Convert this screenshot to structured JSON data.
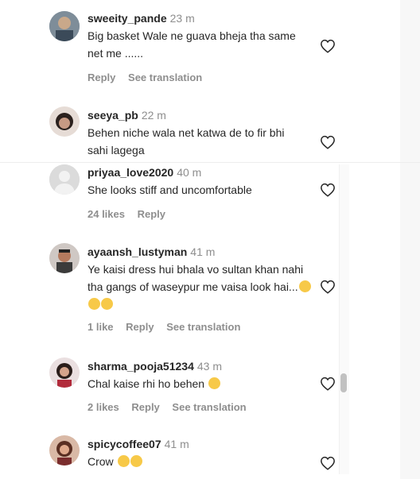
{
  "comments": [
    {
      "user": "sweeity_pande",
      "time": "23 m",
      "text": "Big basket Wale ne guava bheja tha same net me ......",
      "actions": [
        "Reply",
        "See translation"
      ],
      "emoji_count": 0
    },
    {
      "user": "seeya_pb",
      "time": "22 m",
      "text": "Behen niche wala net katwa de to fir bhi sahi lagega",
      "actions": [],
      "emoji_count": 0
    },
    {
      "user": "priyaa_love2020",
      "time": "40 m",
      "text": "She looks stiff and uncomfortable",
      "actions": [
        "24 likes",
        "Reply"
      ],
      "emoji_count": 0
    },
    {
      "user": "ayaansh_lustyman",
      "time": "41 m",
      "text": "Ye kaisi dress hui bhala vo sultan khan nahi tha gangs of waseypur me vaisa look hai...",
      "actions": [
        "1 like",
        "Reply",
        "See translation"
      ],
      "emoji_count": 3
    },
    {
      "user": "sharma_pooja51234",
      "time": "43 m",
      "text": "Chal kaise rhi ho behen",
      "actions": [
        "2 likes",
        "Reply",
        "See translation"
      ],
      "emoji_count": 1
    },
    {
      "user": "spicycoffee07",
      "time": "41 m",
      "text": "Crow",
      "actions": [],
      "emoji_count": 2
    }
  ],
  "icons": {
    "like": "heart-outline-icon",
    "emoji": "laughing-emoji-icon"
  }
}
